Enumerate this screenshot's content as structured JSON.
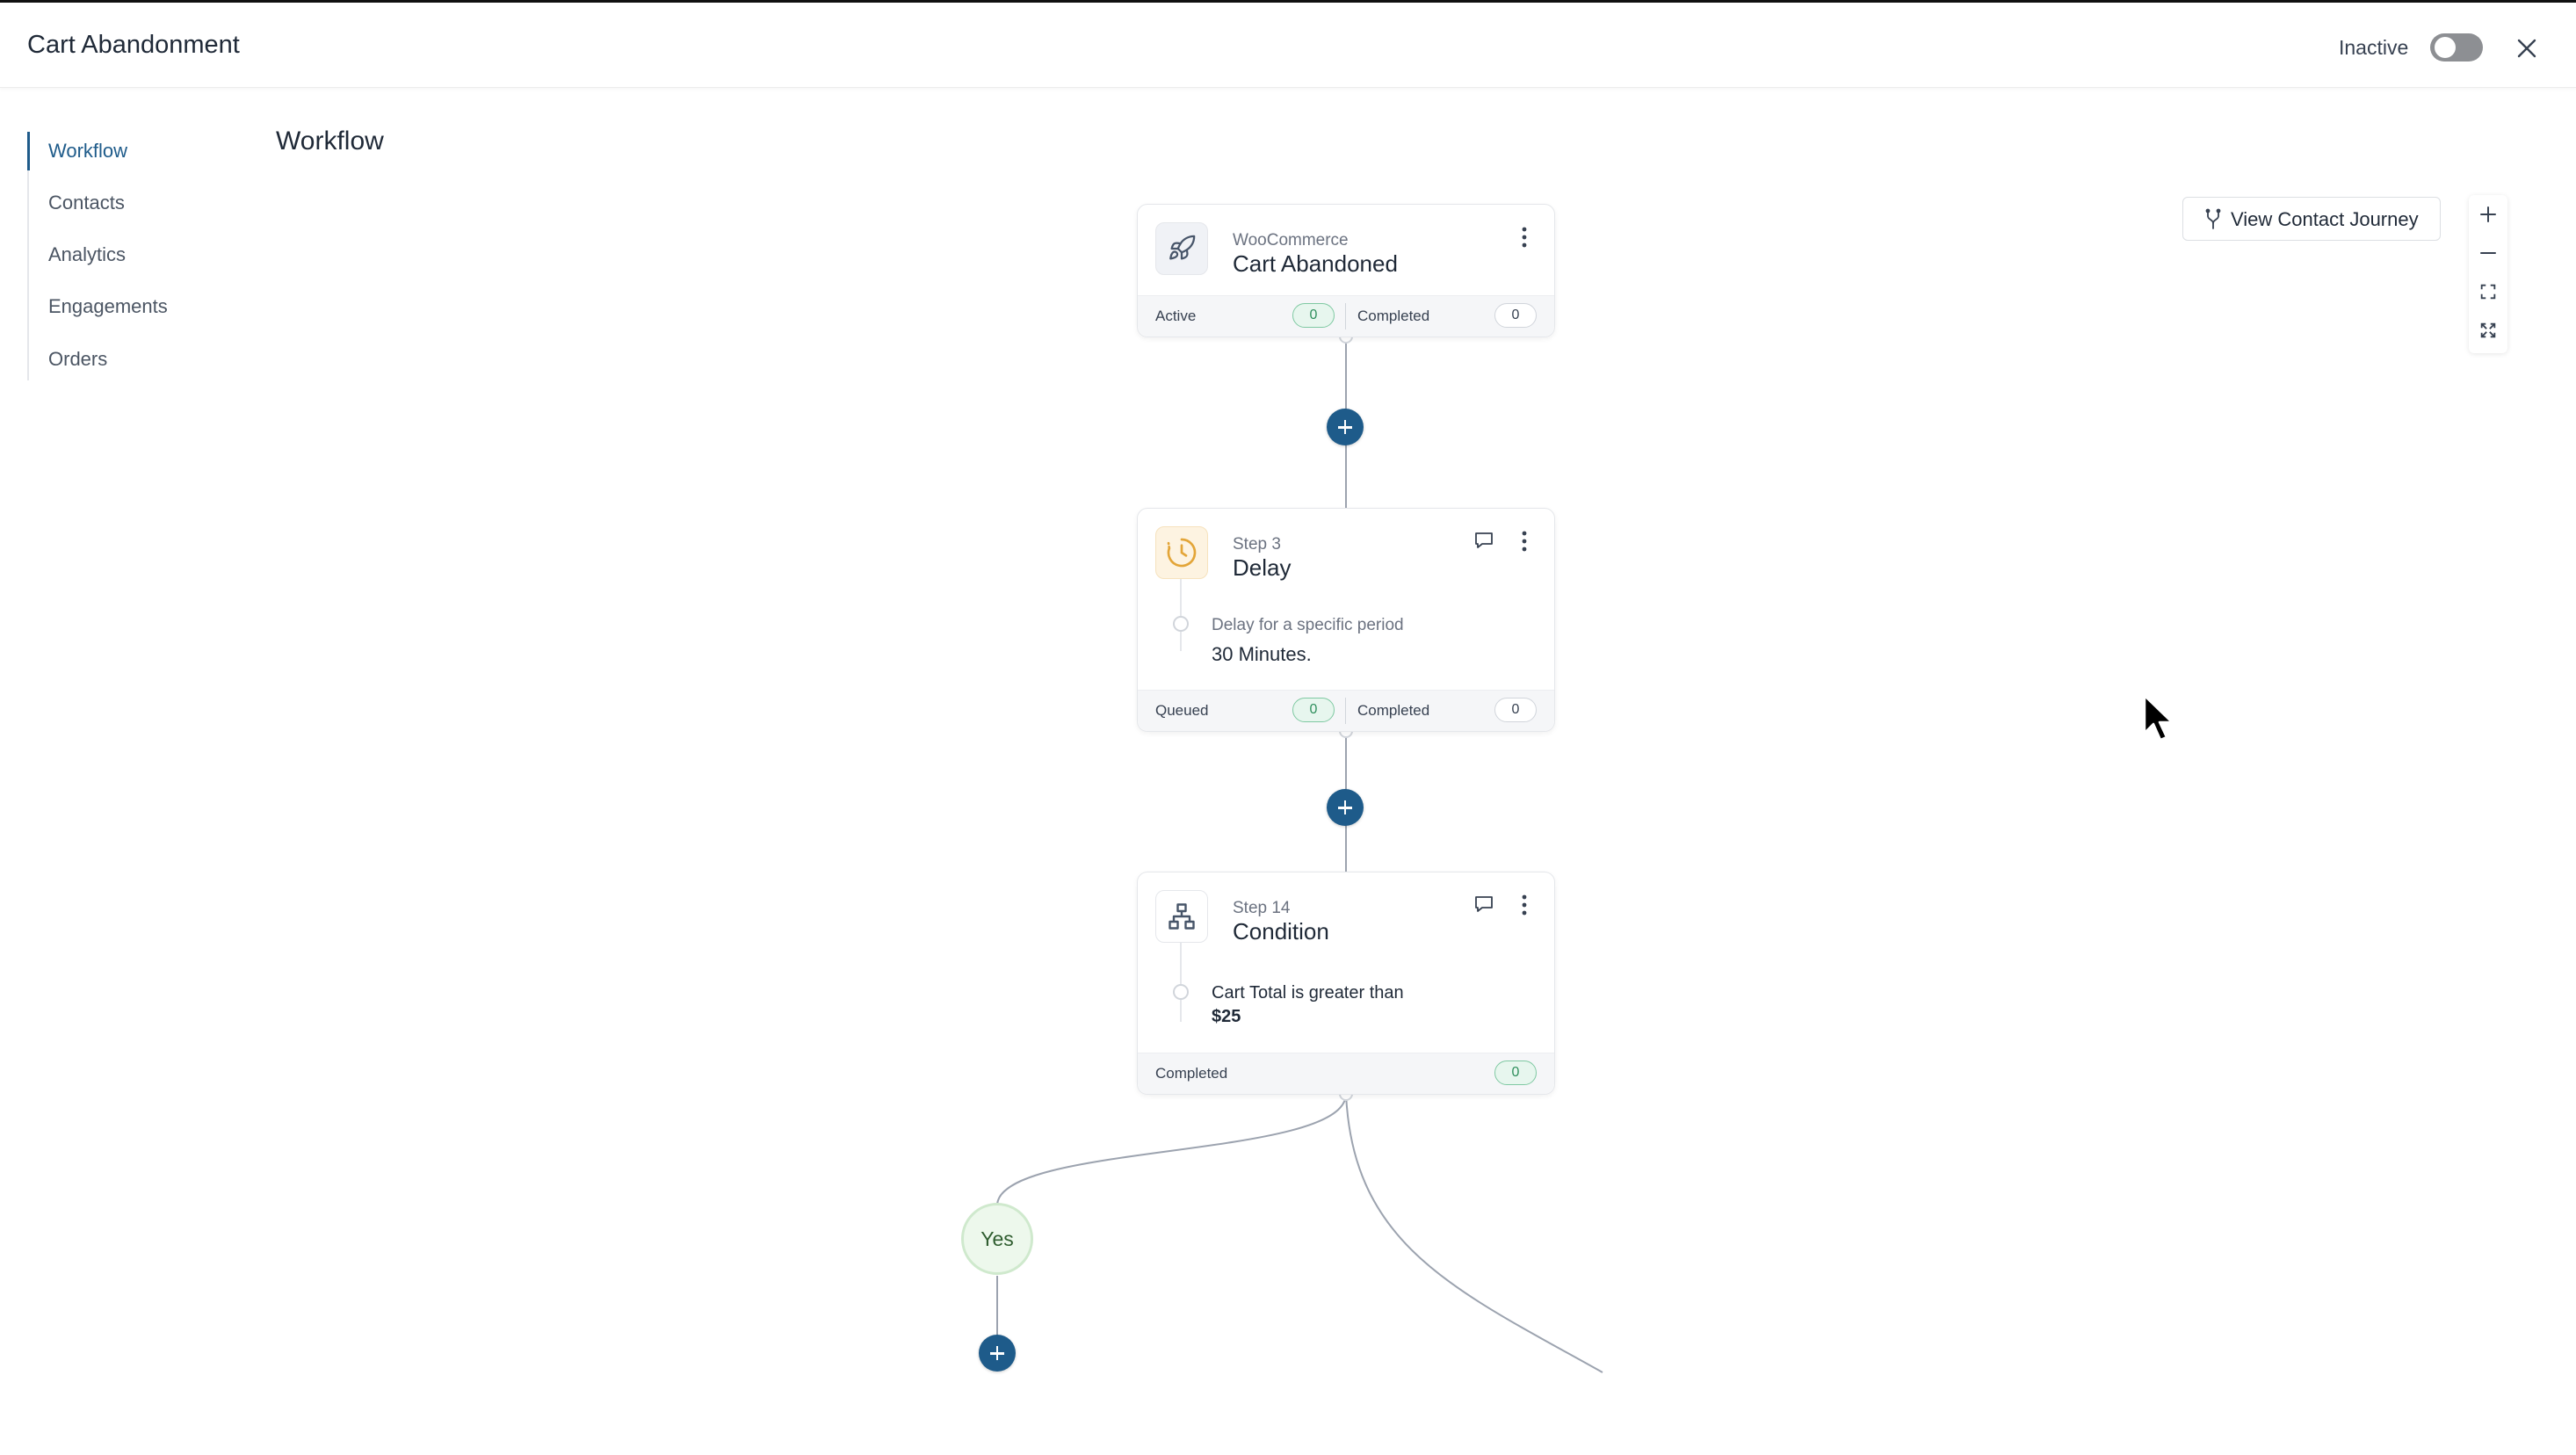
{
  "header": {
    "title": "Cart Abandonment",
    "status_label": "Inactive",
    "toggle_on": false
  },
  "sidebar": {
    "items": [
      {
        "label": "Workflow",
        "active": true
      },
      {
        "label": "Contacts",
        "active": false
      },
      {
        "label": "Analytics",
        "active": false
      },
      {
        "label": "Engagements",
        "active": false
      },
      {
        "label": "Orders",
        "active": false
      }
    ]
  },
  "main": {
    "section_title": "Workflow",
    "view_journey_label": "View Contact Journey"
  },
  "nodes": {
    "trigger": {
      "icon": "rocket-icon",
      "subtitle": "WooCommerce",
      "title": "Cart Abandoned",
      "footer": {
        "left_label": "Active",
        "left_count": "0",
        "right_label": "Completed",
        "right_count": "0"
      }
    },
    "delay": {
      "icon": "clock-icon",
      "subtitle": "Step 3",
      "title": "Delay",
      "detail_label": "Delay for a specific period",
      "detail_value": "30 Minutes.",
      "footer": {
        "left_label": "Queued",
        "left_count": "0",
        "right_label": "Completed",
        "right_count": "0"
      }
    },
    "condition": {
      "icon": "hierarchy-icon",
      "subtitle": "Step 14",
      "title": "Condition",
      "detail_label": "Cart Total is greater than",
      "detail_value": "$25",
      "footer": {
        "label": "Completed",
        "count": "0"
      }
    },
    "yes_branch": {
      "label": "Yes"
    }
  },
  "colors": {
    "accent": "#1e5b8a",
    "success_pill_bg": "#e7f6ee",
    "success_pill_border": "#7fc9a2",
    "toggle_off": "#8d8f93"
  }
}
